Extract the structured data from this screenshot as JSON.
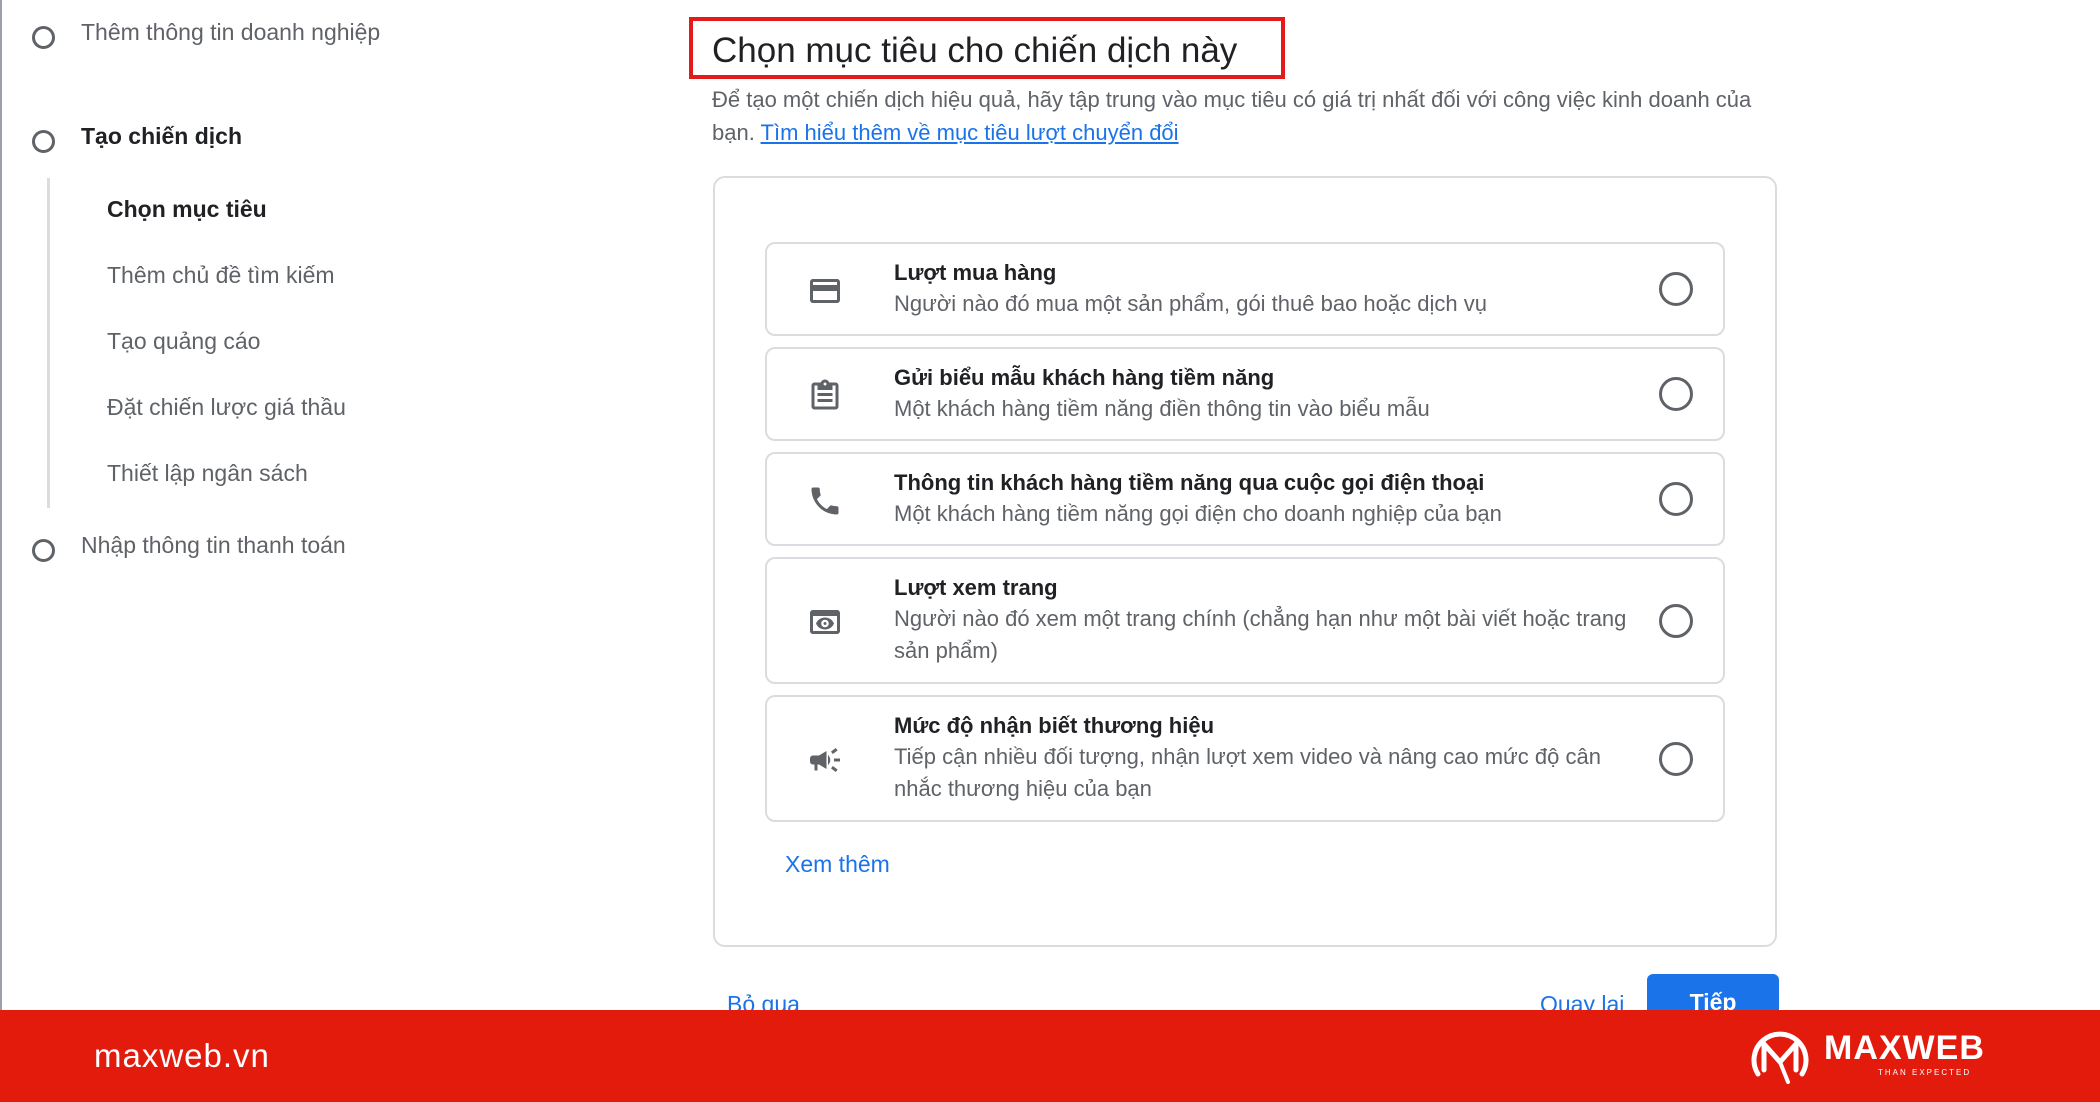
{
  "sidebar": {
    "steps": [
      {
        "label": "Thêm thông tin doanh nghiệp"
      },
      {
        "label": "Tạo chiến dịch"
      },
      {
        "label": "Nhập thông tin thanh toán"
      }
    ],
    "substeps": [
      {
        "label": "Chọn mục tiêu"
      },
      {
        "label": "Thêm chủ đề tìm kiếm"
      },
      {
        "label": "Tạo quảng cáo"
      },
      {
        "label": "Đặt chiến lược giá thầu"
      },
      {
        "label": "Thiết lập ngân sách"
      }
    ]
  },
  "main": {
    "title": "Chọn mục tiêu cho chiến dịch này",
    "description": "Để tạo một chiến dịch hiệu quả, hãy tập trung vào mục tiêu có giá trị nhất đối với công việc kinh doanh của bạn. ",
    "learn_more_link": "Tìm hiểu thêm về mục tiêu lượt chuyển đổi",
    "options": [
      {
        "icon": "credit-card-icon",
        "title": "Lượt mua hàng",
        "description": "Người nào đó mua một sản phẩm, gói thuê bao hoặc dịch vụ"
      },
      {
        "icon": "clipboard-icon",
        "title": "Gửi biểu mẫu khách hàng tiềm năng",
        "description": "Một khách hàng tiềm năng điền thông tin vào biểu mẫu"
      },
      {
        "icon": "phone-icon",
        "title": "Thông tin khách hàng tiềm năng qua cuộc gọi điện thoại",
        "description": "Một khách hàng tiềm năng gọi điện cho doanh nghiệp của bạn"
      },
      {
        "icon": "page-view-icon",
        "title": "Lượt xem trang",
        "description": "Người nào đó xem một trang chính (chẳng hạn như một bài viết hoặc trang sản phẩm)"
      },
      {
        "icon": "megaphone-icon",
        "title": "Mức độ nhận biết thương hiệu",
        "description": "Tiếp cận nhiều đối tượng, nhận lượt xem video và nâng cao mức độ cân nhắc thương hiệu của bạn"
      }
    ],
    "see_more": "Xem thêm",
    "skip_button": "Bỏ qua",
    "back_button": "Quay lại",
    "next_button": "Tiếp"
  },
  "banner": {
    "site": "maxweb.vn",
    "logo_text": "MAXWEB",
    "logo_tagline": "THAN EXPECTED"
  },
  "colors": {
    "accent": "#1a73e8",
    "banner": "#e31b0c",
    "highlight_border": "#e31b1b"
  }
}
